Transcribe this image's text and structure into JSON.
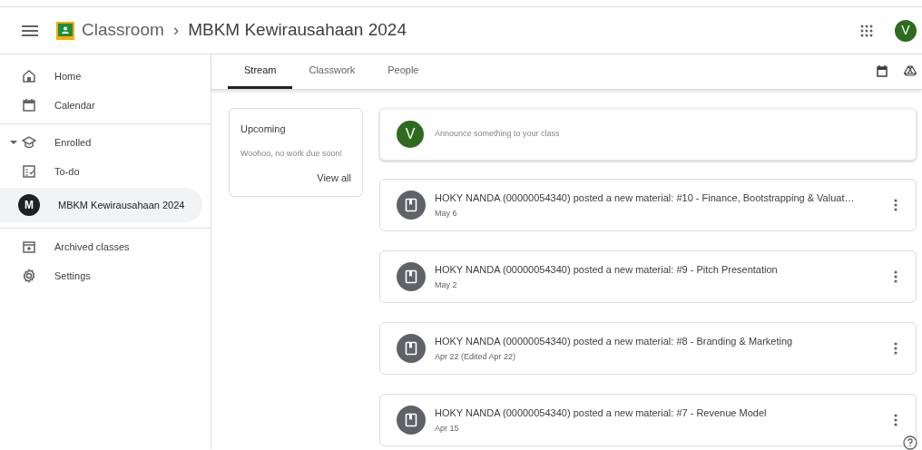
{
  "header": {
    "app": "Classroom",
    "separator": "›",
    "course": "MBKM Kewirausahaan 2024",
    "avatar": "V"
  },
  "sidebar": {
    "sections": [
      [
        {
          "kind": "home",
          "label": "Home",
          "selected": false
        },
        {
          "kind": "calendar",
          "label": "Calendar",
          "selected": false
        }
      ],
      [
        {
          "kind": "enrolled",
          "label": "Enrolled",
          "selected": false,
          "expanded": true
        },
        {
          "kind": "todo",
          "label": "To-do",
          "selected": false
        },
        {
          "kind": "class",
          "label": "MBKM Kewirausahaan 2024",
          "initial": "M",
          "selected": true
        }
      ],
      [
        {
          "kind": "archive",
          "label": "Archived classes",
          "selected": false
        },
        {
          "kind": "settings",
          "label": "Settings",
          "selected": false
        }
      ]
    ]
  },
  "tabs": [
    {
      "label": "Stream",
      "selected": true
    },
    {
      "label": "Classwork",
      "selected": false
    },
    {
      "label": "People",
      "selected": false
    }
  ],
  "upcoming": {
    "title": "Upcoming",
    "message": "Woohoo, no work due soon!",
    "link": "View all"
  },
  "announce": {
    "avatar": "V",
    "placeholder": "Announce something to your class"
  },
  "posts": [
    {
      "text": "HOKY NANDA (00000054340) posted a new material: #10 - Finance, Bootstrapping & Valuat…",
      "date": "May 6"
    },
    {
      "text": "HOKY NANDA (00000054340) posted a new material: #9 - Pitch Presentation",
      "date": "May 2"
    },
    {
      "text": "HOKY NANDA (00000054340) posted a new material: #8 - Branding & Marketing",
      "date": "Apr 22 (Edited Apr 22)"
    },
    {
      "text": "HOKY NANDA (00000054340) posted a new material: #7 - Revenue Model",
      "date": "Apr 15"
    }
  ]
}
